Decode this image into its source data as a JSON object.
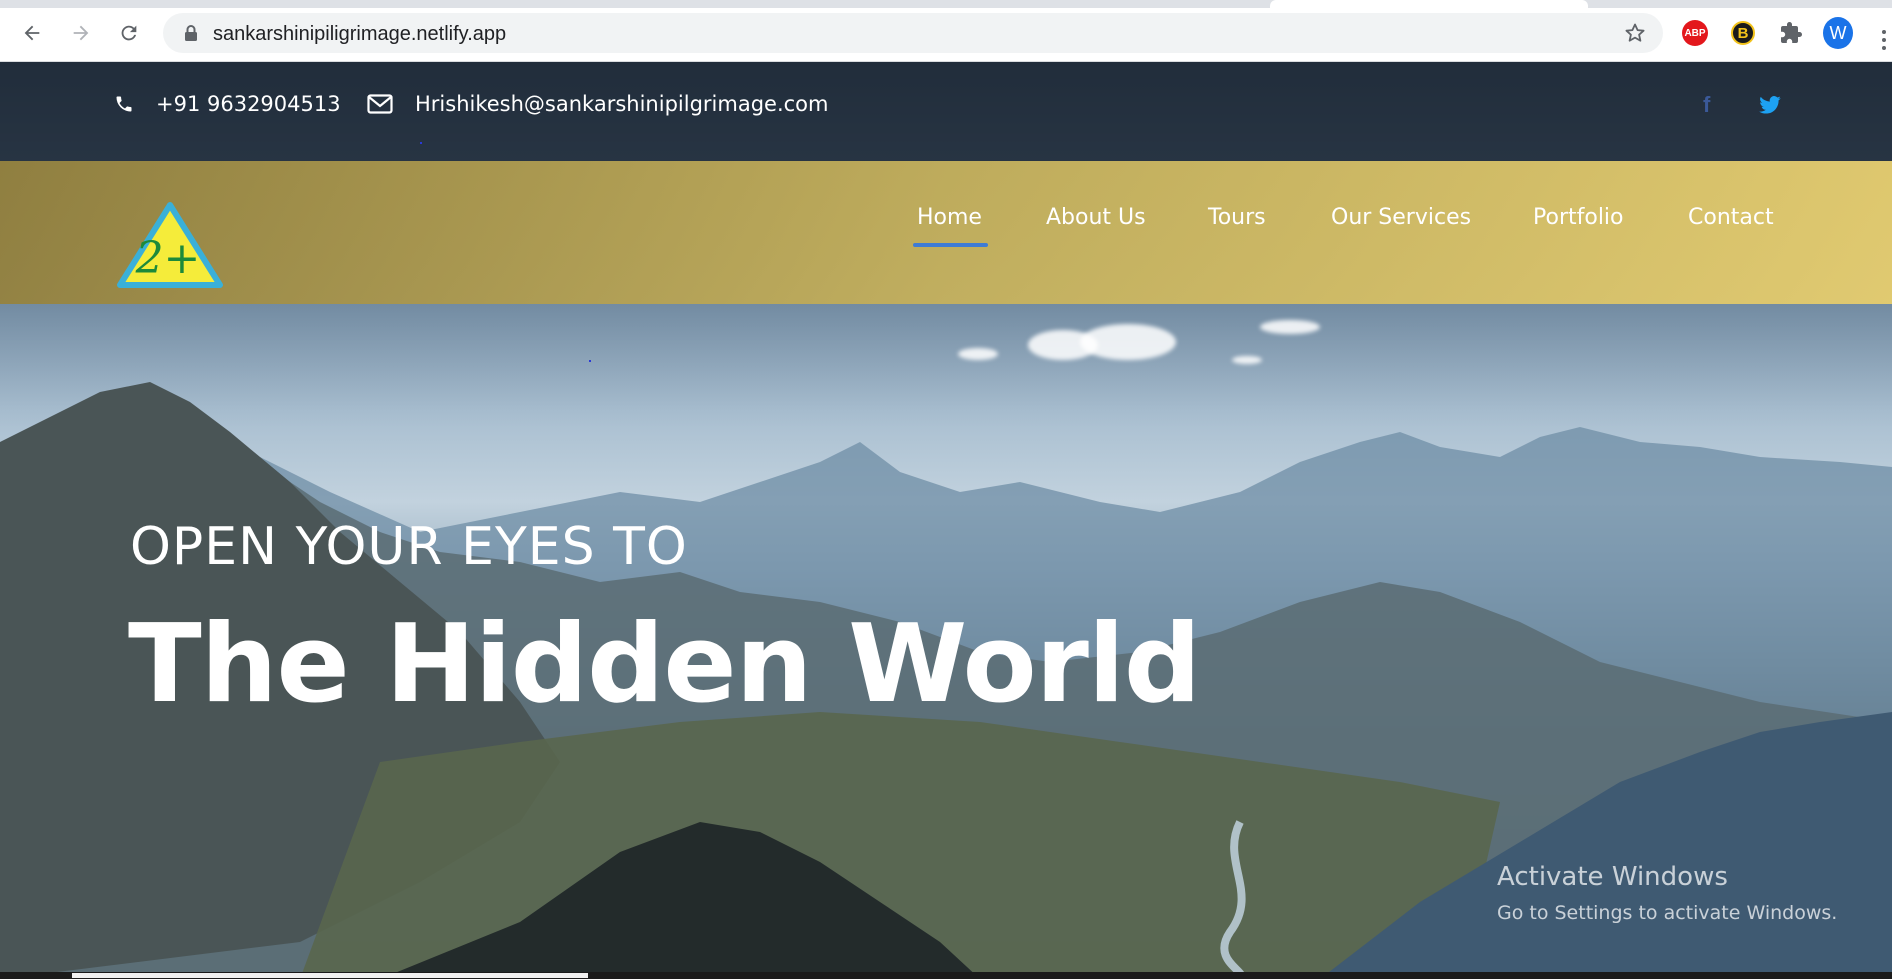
{
  "browser": {
    "url": "sankarshinipiligrimage.netlify.app",
    "extensions": {
      "abp_label": "ABP",
      "b_label": "B",
      "profile_initial": "W"
    }
  },
  "topbar": {
    "phone": "+91 9632904513",
    "email": "Hrishikesh@sankarshinipilgrimage.com",
    "social": {
      "facebook": "f",
      "twitter_icon": "twitter-icon"
    }
  },
  "logo": {
    "text": "2+",
    "colors": {
      "fill": "#f5ec3a",
      "border": "#3ab0d8",
      "text": "#1d8a3a"
    }
  },
  "nav": {
    "items": [
      {
        "label": "Home",
        "active": true
      },
      {
        "label": "About Us"
      },
      {
        "label": "Tours"
      },
      {
        "label": "Our Services"
      },
      {
        "label": "Portfolio"
      },
      {
        "label": "Contact"
      }
    ],
    "active_color": "#3d7bd6"
  },
  "hero": {
    "subtitle": "OPEN YOUR EYES TO",
    "title": "The Hidden World"
  },
  "watermark": {
    "line1": "Activate Windows",
    "line2": "Go to Settings to activate Windows."
  }
}
